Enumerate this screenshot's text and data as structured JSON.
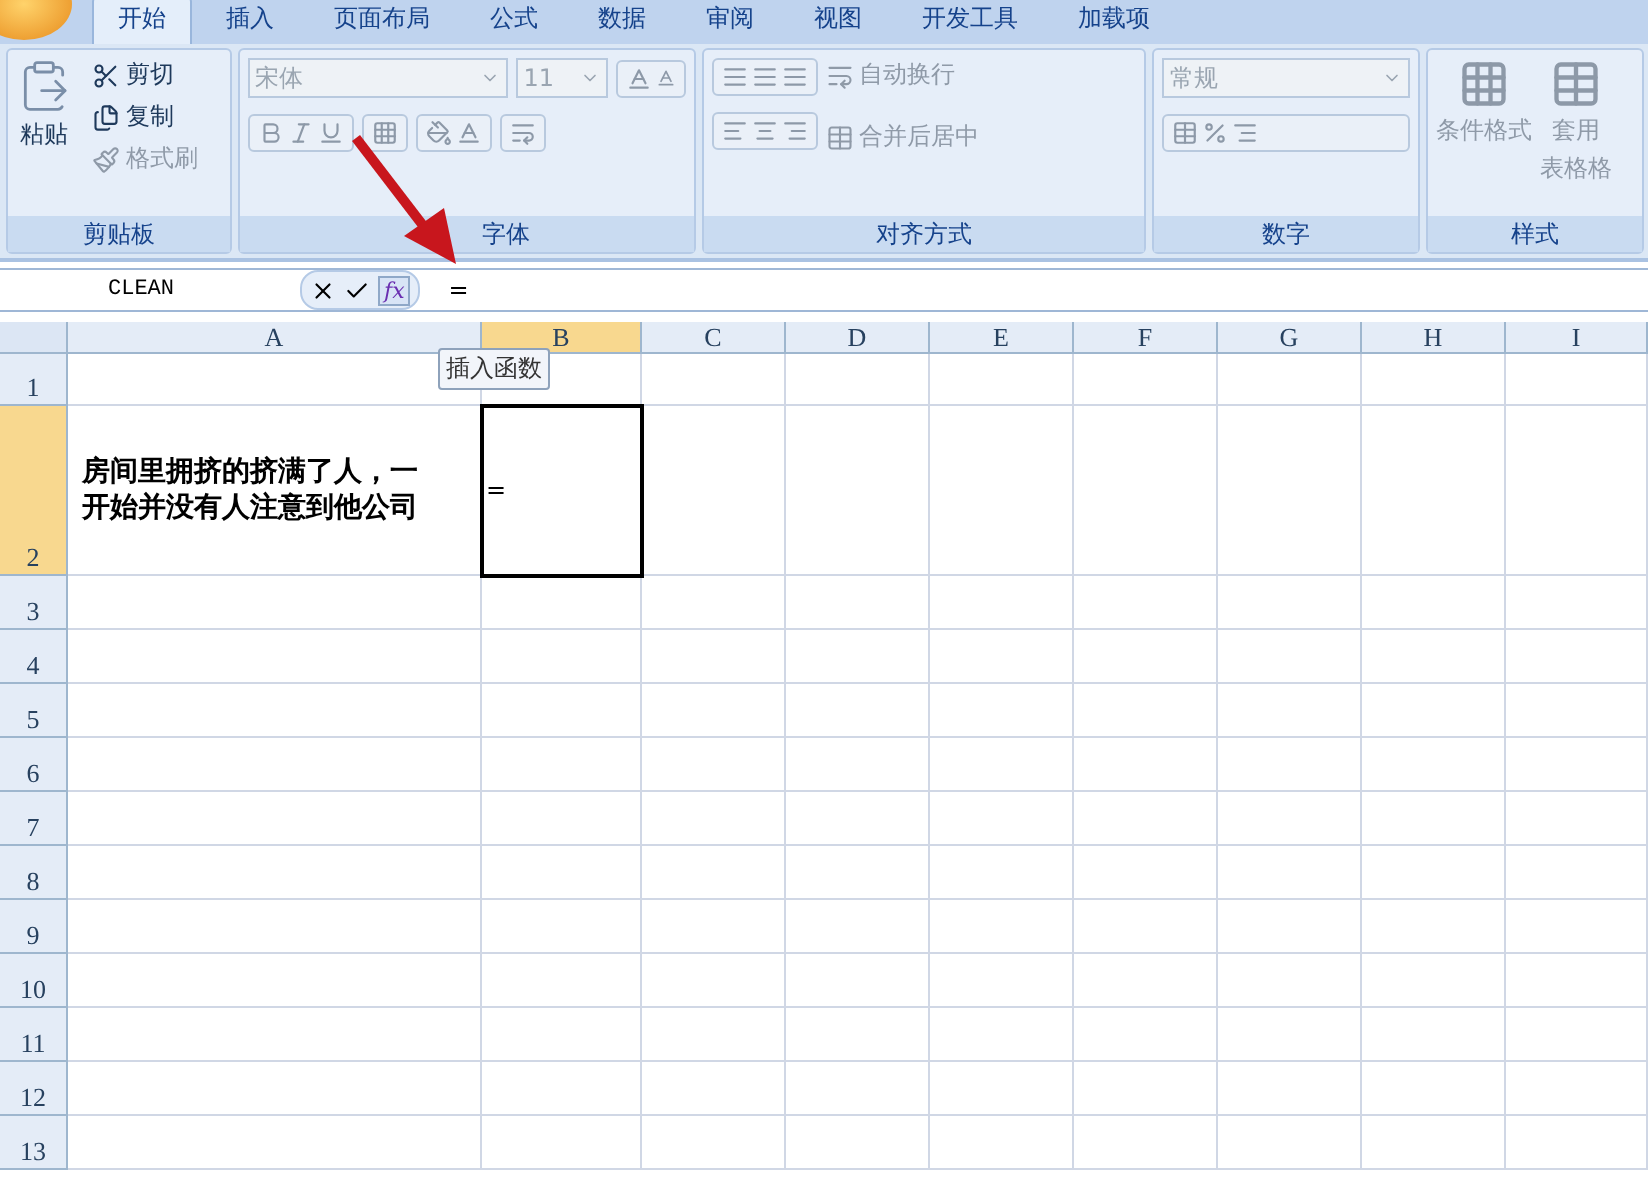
{
  "tabs": [
    {
      "label": "开始",
      "selected": true
    },
    {
      "label": "插入",
      "selected": false
    },
    {
      "label": "页面布局",
      "selected": false
    },
    {
      "label": "公式",
      "selected": false
    },
    {
      "label": "数据",
      "selected": false
    },
    {
      "label": "审阅",
      "selected": false
    },
    {
      "label": "视图",
      "selected": false
    },
    {
      "label": "开发工具",
      "selected": false
    },
    {
      "label": "加载项",
      "selected": false
    }
  ],
  "clipboard": {
    "label": "剪贴板",
    "paste": "粘贴",
    "cut": "剪切",
    "copy": "复制",
    "format_painter": "格式刷",
    "format_painter_disabled": true
  },
  "font": {
    "label": "字体",
    "font_name": "宋体",
    "font_size": "11",
    "disabled": true
  },
  "alignment": {
    "label": "对齐方式",
    "wrap": "自动换行",
    "merge": "合并后居中",
    "disabled": true
  },
  "number": {
    "label": "数字",
    "format": "常规",
    "disabled": true
  },
  "styles": {
    "label": "样式",
    "conditional": "条件格式",
    "table_format": [
      "套用",
      "表格格"
    ],
    "disabled": true
  },
  "formula_bar": {
    "name_box": "CLEAN",
    "fx_label": "fx",
    "formula": "="
  },
  "tooltip": "插入函数",
  "columns": [
    {
      "label": "A",
      "selected": false
    },
    {
      "label": "B",
      "selected": true
    },
    {
      "label": "C",
      "selected": false
    },
    {
      "label": "D",
      "selected": false
    },
    {
      "label": "E",
      "selected": false
    },
    {
      "label": "F",
      "selected": false
    },
    {
      "label": "G",
      "selected": false
    },
    {
      "label": "H",
      "selected": false
    },
    {
      "label": "I",
      "selected": false
    }
  ],
  "rows": [
    {
      "label": "1",
      "selected": false,
      "cells": []
    },
    {
      "label": "2",
      "selected": true,
      "cells": [
        {
          "text": "房间里拥挤的挤满了人，一开始并没有人注意到他公司",
          "active": false
        },
        {
          "text": "=",
          "active": true
        }
      ]
    },
    {
      "label": "3",
      "selected": false,
      "cells": []
    },
    {
      "label": "4",
      "selected": false,
      "cells": []
    },
    {
      "label": "5",
      "selected": false,
      "cells": []
    },
    {
      "label": "6",
      "selected": false,
      "cells": []
    },
    {
      "label": "7",
      "selected": false,
      "cells": []
    },
    {
      "label": "8",
      "selected": false,
      "cells": []
    },
    {
      "label": "9",
      "selected": false,
      "cells": []
    },
    {
      "label": "10",
      "selected": false,
      "cells": []
    },
    {
      "label": "11",
      "selected": false,
      "cells": []
    },
    {
      "label": "12",
      "selected": false,
      "cells": []
    },
    {
      "label": "13",
      "selected": false,
      "cells": []
    }
  ]
}
